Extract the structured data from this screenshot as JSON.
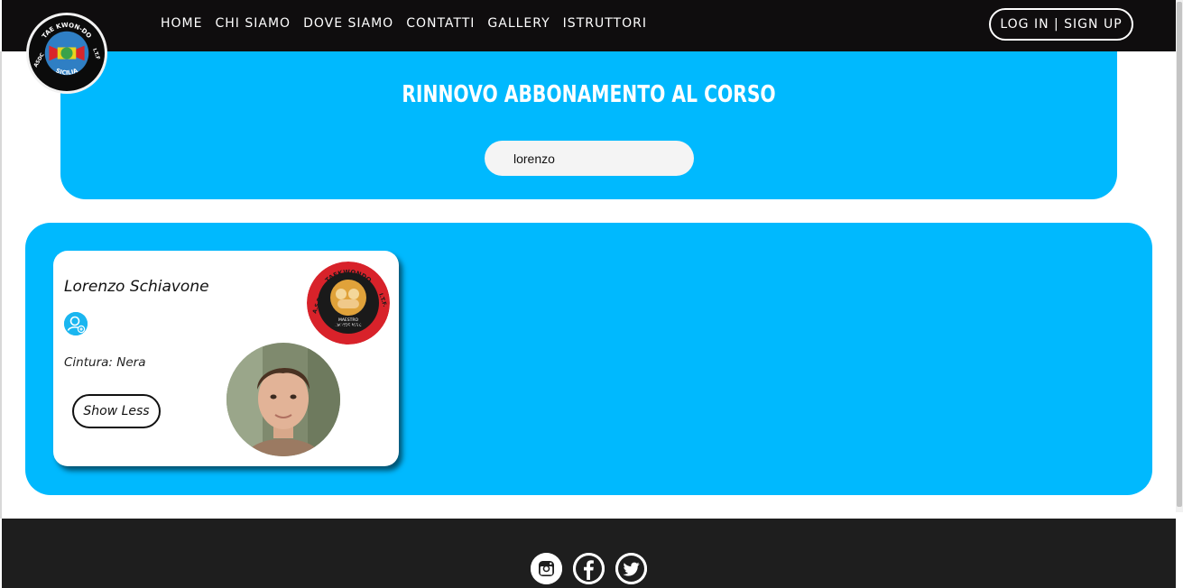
{
  "nav": {
    "links": [
      {
        "label": "HOME"
      },
      {
        "label": "CHI SIAMO"
      },
      {
        "label": "DOVE SIAMO"
      },
      {
        "label": "CONTATTI"
      },
      {
        "label": "GALLERY"
      },
      {
        "label": "ISTRUTTORI"
      }
    ],
    "login_label": "LOG IN | SIGN UP",
    "logo_text_top": "TAE KWON-DO",
    "logo_text_bottom": "SICILIA",
    "logo_text_left": "ASDC",
    "logo_text_right": "I.T.F",
    "logo_icon": "club-logo"
  },
  "hero": {
    "title": "RINNOVO ABBONAMENTO AL CORSO",
    "search_value": "lorenzo"
  },
  "results": {
    "members": [
      {
        "name": "Lorenzo Schiavone",
        "belt": "Cintura: Nera",
        "toggle_label": "Show Less",
        "action_icon": "user-add-icon",
        "badge_text_top": "TAEKWONDO",
        "badge_text_left": "A.S.D.",
        "badge_text_right": "I.T.F.",
        "badge_text_mid": "MAESTRO",
        "badge_text_mid2": "DAVIDE NIBB",
        "badge_text_bottom": "CATANIA"
      }
    ]
  },
  "footer": {
    "socials": [
      "instagram-icon",
      "facebook-icon",
      "twitter-icon"
    ]
  },
  "colors": {
    "accent": "#00b9fe",
    "nav_bg": "#0f0d0e",
    "footer_bg": "#1e1e1e"
  }
}
